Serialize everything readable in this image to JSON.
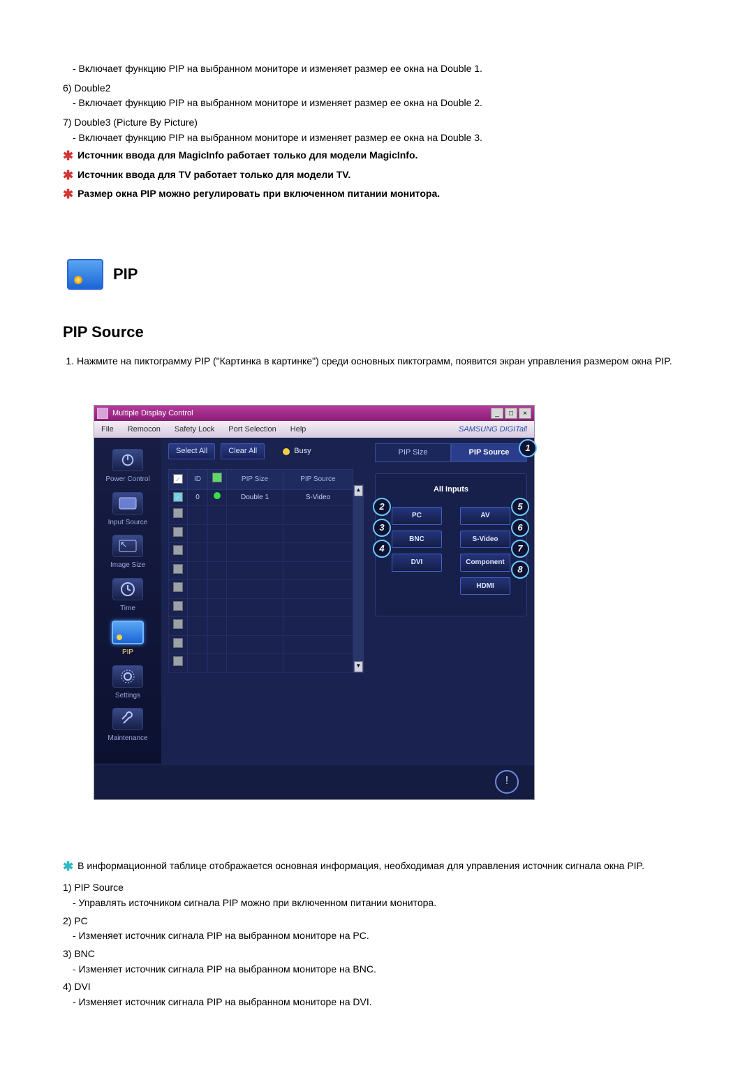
{
  "top_list": [
    {
      "body": "- Включает функцию PIP на выбранном мониторе и изменяет размер ее окна на Double 1."
    },
    {
      "head": "6)  Double2",
      "body": "- Включает функцию PIP на выбранном мониторе и изменяет размер ее окна на Double 2."
    },
    {
      "head": "7)  Double3 (Picture By Picture)",
      "body": "- Включает функцию PIP на выбранном мониторе и изменяет размер ее окна на Double 3."
    }
  ],
  "stars": [
    "Источник ввода для MagicInfo работает только для модели MagicInfo.",
    "Источник ввода для TV работает только для модели TV.",
    "Размер окна PIP можно регулировать при включенном питании монитора."
  ],
  "section_icon_title": "PIP",
  "h2": "PIP Source",
  "intro_list": [
    "Нажмите на пиктограмму PIP (\"Картинка в картинке\") среди основных пиктограмм, появится экран управления размером окна PIP."
  ],
  "mdc": {
    "title": "Multiple Display Control",
    "menubar": [
      "File",
      "Remocon",
      "Safety Lock",
      "Port Selection",
      "Help"
    ],
    "brand": "SAMSUNG DIGITall",
    "sidebar": [
      {
        "label": "Power Control"
      },
      {
        "label": "Input Source"
      },
      {
        "label": "Image Size"
      },
      {
        "label": "Time"
      },
      {
        "label": "PIP",
        "selected": true
      },
      {
        "label": "Settings"
      },
      {
        "label": "Maintenance"
      }
    ],
    "top_buttons": {
      "select": "Select All",
      "clear": "Clear All",
      "busy": "Busy"
    },
    "table": {
      "headers": [
        "",
        "ID",
        "",
        "PIP Size",
        "PIP Source"
      ],
      "row1": {
        "id": "0",
        "size": "Double 1",
        "source": "S-Video"
      }
    },
    "tabs": {
      "size": "PIP Size",
      "source": "PIP Source"
    },
    "panel_title": "All Inputs",
    "options_left": [
      "PC",
      "BNC",
      "DVI"
    ],
    "options_right": [
      "AV",
      "S-Video",
      "Component",
      "HDMI"
    ],
    "callouts": {
      "c1": "1",
      "c2": "2",
      "c3": "3",
      "c4": "4",
      "c5": "5",
      "c6": "6",
      "c7": "7",
      "c8": "8"
    }
  },
  "info_note": "В информационной таблице отображается основная информация, необходимая для управления источник сигнала окна PIP.",
  "bottom_list": [
    {
      "head": "1)  PIP Source",
      "body": "- Управлять источником сигнала PIP можно при включенном питании монитора."
    },
    {
      "head": "2)  PC",
      "body": "- Изменяет источник сигнала PIP на выбранном мониторе на PC."
    },
    {
      "head": "3)  BNC",
      "body": "- Изменяет источник сигнала PIP на выбранном мониторе на BNC."
    },
    {
      "head": "4)  DVI",
      "body": "- Изменяет источник сигнала PIP на выбранном мониторе на DVI."
    }
  ]
}
